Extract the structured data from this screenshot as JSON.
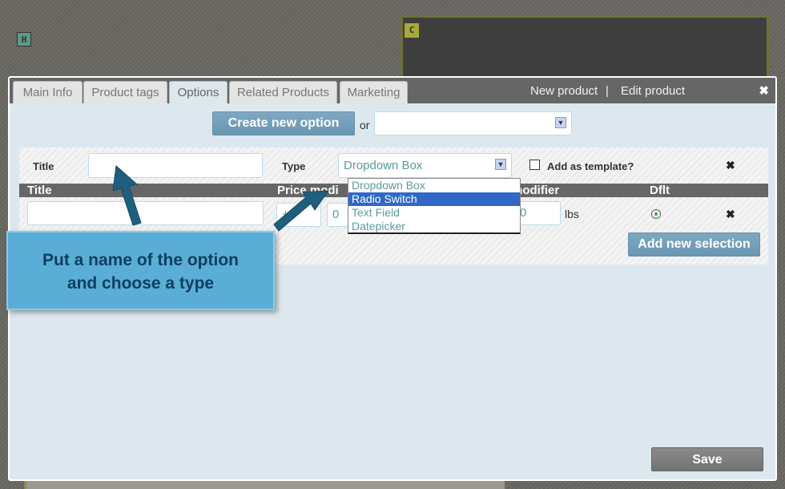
{
  "background": {
    "badge_h": "H",
    "badge_c": "C"
  },
  "tabs": [
    {
      "label": "Main Info"
    },
    {
      "label": "Product tags"
    },
    {
      "label": "Options",
      "active": true
    },
    {
      "label": "Related Products"
    },
    {
      "label": "Marketing"
    }
  ],
  "header": {
    "new_product": "New product",
    "separator": "|",
    "edit_product": "Edit product",
    "close": "✖"
  },
  "create": {
    "button": "Create new option",
    "or": "or",
    "template_select": ""
  },
  "option": {
    "title_label": "Title",
    "title_value": "",
    "type_label": "Type",
    "type_value": "Dropdown Box",
    "type_options": [
      "Dropdown Box",
      "Radio Switch",
      "Text Field",
      "Datepicker"
    ],
    "highlighted_option": "Radio Switch",
    "add_template_label": "Add as template?",
    "add_template_checked": false,
    "remove": "✖"
  },
  "selections": {
    "columns": [
      "Title",
      "Price modi",
      "modifier",
      "Dflt"
    ],
    "row": {
      "title": "",
      "price_sign": "+",
      "price_value": "0",
      "weight_value": "0",
      "weight_unit": "lbs",
      "default": true,
      "remove": "✖"
    },
    "add_button": "Add new selection"
  },
  "callout": {
    "line1": "Put a name of the option",
    "line2": "and choose a type"
  },
  "footer": {
    "save": "Save"
  },
  "colors": {
    "accent": "#6a96b2",
    "highlight": "#3168c8",
    "callout": "#5aaed6",
    "arrow": "#1f5f7e"
  }
}
